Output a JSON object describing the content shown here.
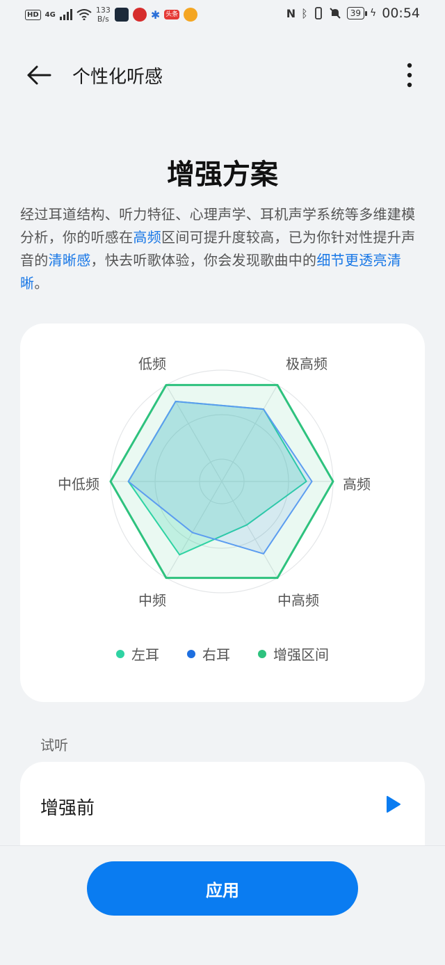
{
  "status_bar": {
    "hd": "HD",
    "network": "4G",
    "speed_value": "133",
    "speed_unit": "B/s",
    "battery": "39",
    "time": "00:54",
    "app_badge_text": "头条"
  },
  "header": {
    "title": "个性化听感"
  },
  "plan": {
    "title": "增强方案",
    "desc_part1": "经过耳道结构、听力特征、心理声学、耳机声学系统等多维建模分析，你的听感在",
    "highlight1": "高频",
    "desc_part2": "区间可提升度较高，已为你针对性提升声音的",
    "highlight2": "清晰感",
    "desc_part3": "，快去听歌体验，你会发现歌曲中的",
    "highlight3": "细节更透亮清晰",
    "desc_part4": "。"
  },
  "chart_data": {
    "type": "radar",
    "axes": [
      "极高频",
      "高频",
      "中高频",
      "中频",
      "中低频",
      "低频"
    ],
    "scale_max": 1.0,
    "series": [
      {
        "name": "左耳",
        "values": [
          0.75,
          0.76,
          0.45,
          0.76,
          0.84,
          0.83
        ],
        "color": "#2fd3a3"
      },
      {
        "name": "右耳",
        "values": [
          0.75,
          0.81,
          0.75,
          0.53,
          0.84,
          0.83
        ],
        "color": "#1e6fe0"
      },
      {
        "name": "增强区间",
        "values": [
          1.0,
          1.0,
          1.0,
          1.0,
          1.0,
          1.0
        ],
        "color": "#2ec27e"
      }
    ],
    "legend": [
      "左耳",
      "右耳",
      "增强区间"
    ]
  },
  "colors": {
    "accent": "#0a7cf1",
    "highlight_text": "#1877e6"
  },
  "trial": {
    "section_label": "试听",
    "before_label": "增强前"
  },
  "footer": {
    "apply_label": "应用"
  }
}
